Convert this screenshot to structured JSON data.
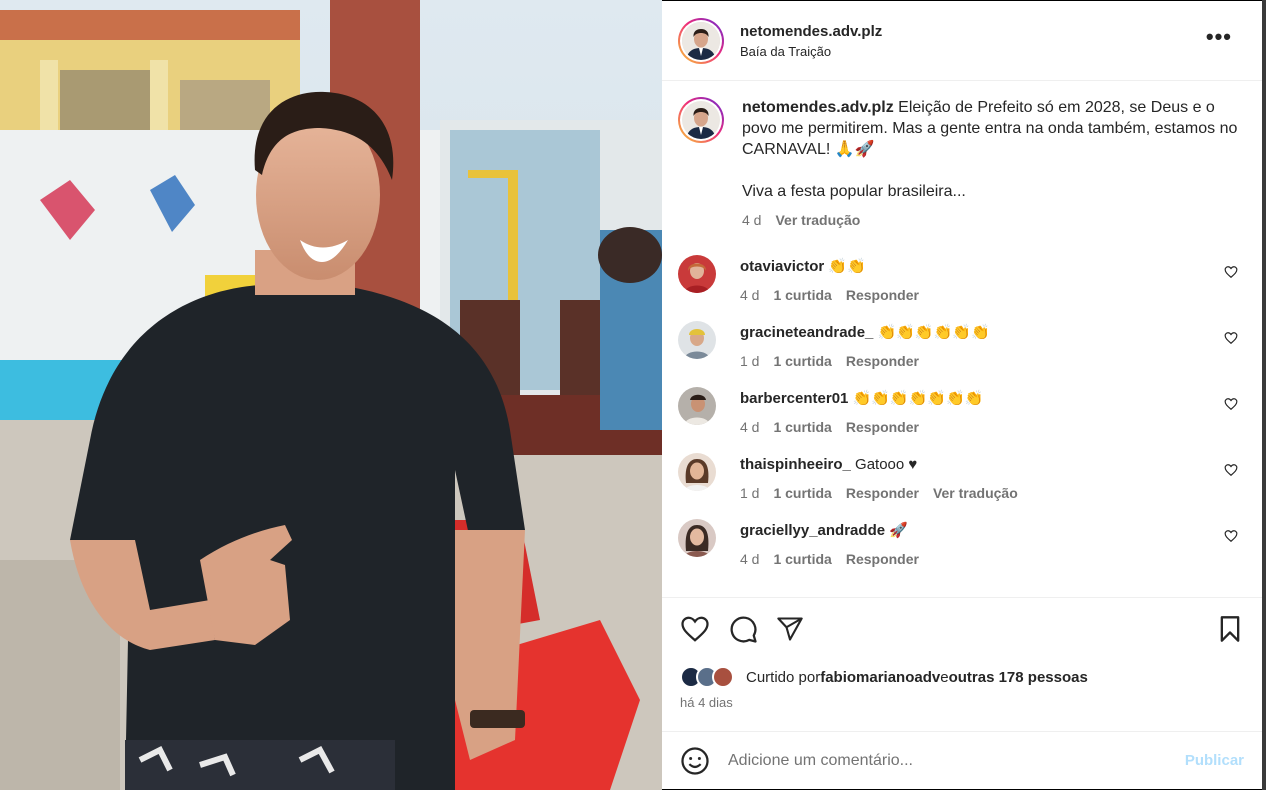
{
  "post": {
    "author": "netomendes.adv.plz",
    "location": "Baía da Traição",
    "more_label": "•••",
    "caption_line1": " Eleição de Prefeito só em 2028, se Deus e o povo me permitirem. Mas a gente entra na onda também, estamos no CARNAVAL! 🙏🚀",
    "caption_line2": "Viva a festa popular brasileira...",
    "caption_age": "4 d",
    "caption_translate": "Ver tradução"
  },
  "comments": [
    {
      "user": "otaviavictor",
      "text": " 👏👏",
      "age": "4 d",
      "likes": "1 curtida",
      "reply": "Responder",
      "translate": ""
    },
    {
      "user": "gracineteandrade_",
      "text": " 👏👏👏👏👏👏",
      "age": "1 d",
      "likes": "1 curtida",
      "reply": "Responder",
      "translate": ""
    },
    {
      "user": "barbercenter01",
      "text": " 👏👏👏👏👏👏👏",
      "age": "4 d",
      "likes": "1 curtida",
      "reply": "Responder",
      "translate": ""
    },
    {
      "user": "thaispinheeiro_",
      "text": " Gatooo ♥",
      "age": "1 d",
      "likes": "1 curtida",
      "reply": "Responder",
      "translate": "Ver tradução"
    },
    {
      "user": "graciellyy_andradde",
      "text": " 🚀",
      "age": "4 d",
      "likes": "1 curtida",
      "reply": "Responder",
      "translate": ""
    }
  ],
  "likes": {
    "prefix": "Curtido por ",
    "first_user": "fabiomarianoadv",
    "middle": " e ",
    "others": "outras 178 pessoas"
  },
  "timestamp": "há 4 dias",
  "add_comment": {
    "placeholder": "Adicione um comentário...",
    "publish": "Publicar"
  },
  "icons": {
    "like": "heart-icon",
    "comment": "comment-icon",
    "share": "paper-plane-icon",
    "save": "bookmark-icon",
    "emoji": "smiley-icon"
  },
  "colors": {
    "text": "#262626",
    "muted": "#737373",
    "publish_disabled": "#b2dffc",
    "story_ring_start": "#f9ce34",
    "story_ring_end": "#6228d7"
  }
}
